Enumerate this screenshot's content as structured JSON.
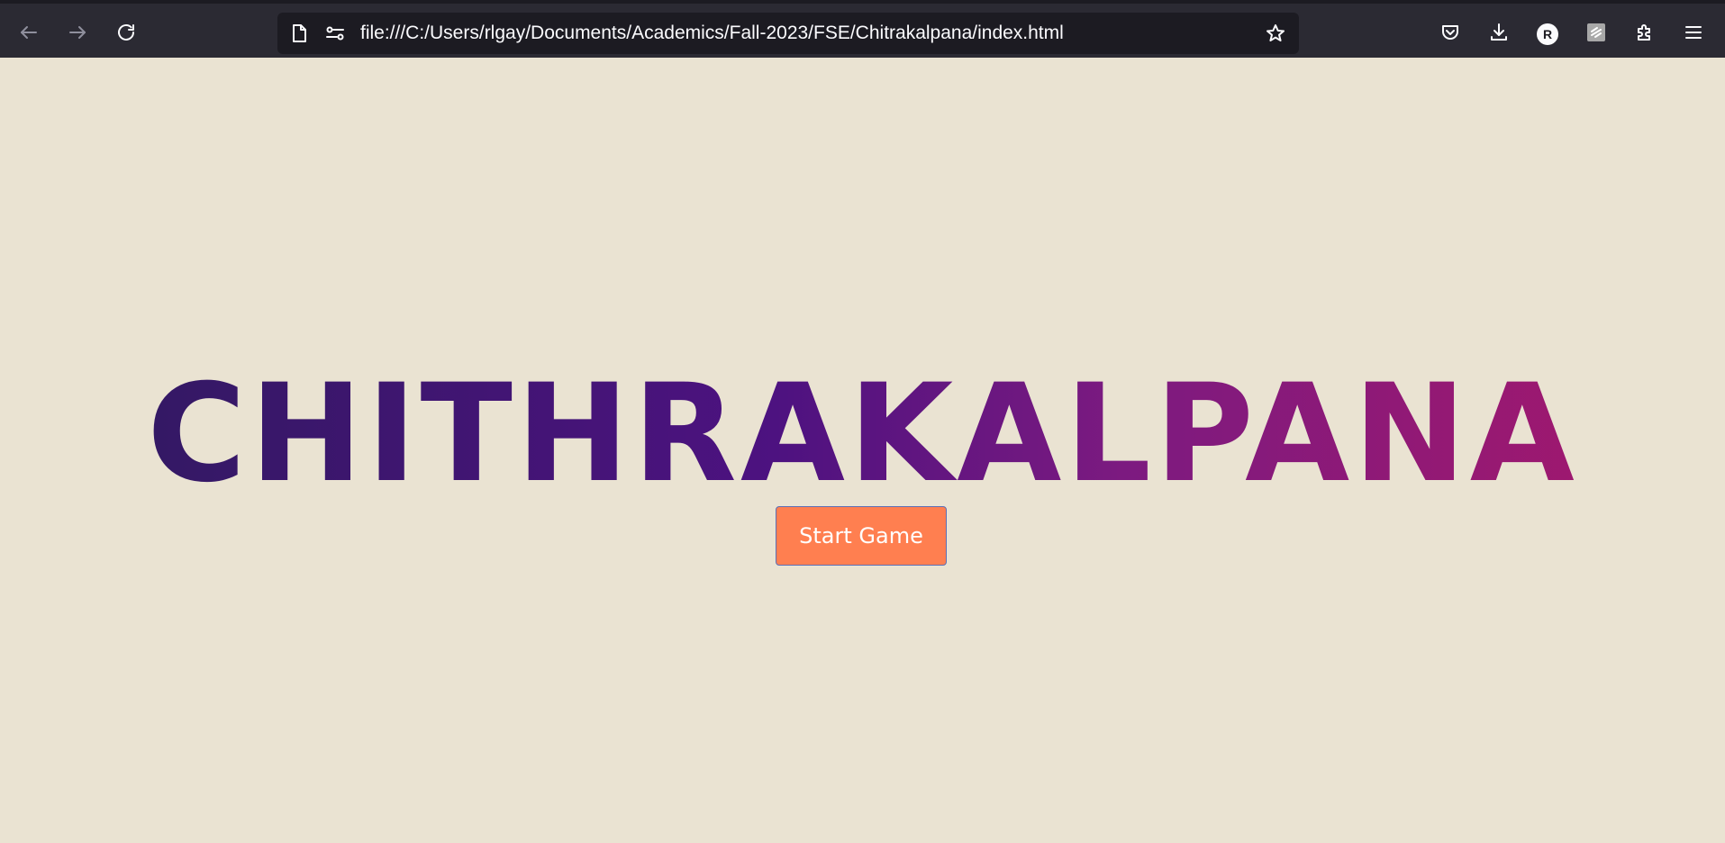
{
  "browser": {
    "url": "file:///C:/Users/rlgay/Documents/Academics/Fall-2023/FSE/Chitrakalpana/index.html",
    "account_initial": "R",
    "icons": [
      "back-icon",
      "forward-icon",
      "reload-icon",
      "page-icon",
      "permissions-icon",
      "bookmark-star-icon",
      "pocket-icon",
      "downloads-icon",
      "account-icon",
      "extension-icon",
      "extensions-puzzle-icon",
      "menu-icon"
    ]
  },
  "page": {
    "background_color": "#eae3d2",
    "title": "CHITHRAKALPANA",
    "title_gradient": [
      "#2e1a5e",
      "#4d1280",
      "#7c1a80",
      "#a8186a"
    ],
    "start_button_label": "Start Game",
    "start_button_color": "#ff7f50"
  }
}
